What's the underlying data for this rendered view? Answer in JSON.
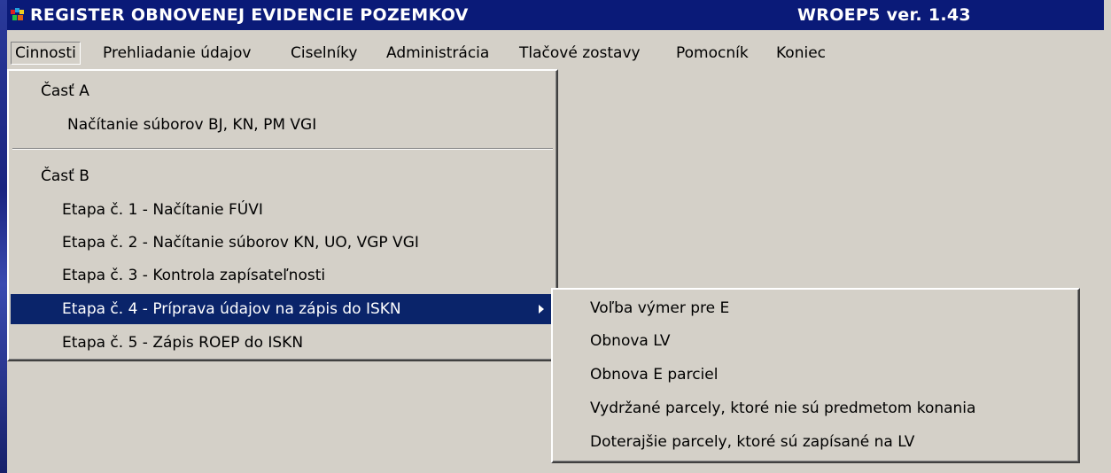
{
  "window": {
    "title": "REGISTER OBNOVENEJ EVIDENCIE POZEMKOV",
    "version": "WROEP5 ver. 1.43"
  },
  "menubar": {
    "items": [
      {
        "label": "Cinnosti"
      },
      {
        "label": "Prehliadanie údajov"
      },
      {
        "label": "Ciselníky"
      },
      {
        "label": "Administrácia"
      },
      {
        "label": "Tlačové zostavy"
      },
      {
        "label": "Pomocník"
      },
      {
        "label": "Koniec"
      }
    ]
  },
  "dropdown": {
    "section_a": "Časť A",
    "a_items": [
      "Načítanie súborov BJ, KN, PM VGI"
    ],
    "section_b": "Časť B",
    "b_items": [
      "Etapa č. 1 - Načítanie FÚVI",
      "Etapa č. 2 - Načítanie súborov KN, UO, VGP VGI",
      "Etapa č. 3 - Kontrola zapísateľnosti",
      "Etapa č. 4 - Príprava  údajov na zápis do ISKN",
      "Etapa č. 5 - Zápis ROEP do ISKN"
    ]
  },
  "submenu": {
    "items": [
      "Voľba výmer pre E",
      "Obnova LV",
      "Obnova E parciel",
      "Vydržané parcely, ktoré nie sú predmetom konania",
      "Doterajšie parcely, ktoré sú zapísané na LV"
    ]
  },
  "colors": {
    "titlebar": "#0a1a78",
    "highlight": "#0a246a",
    "face": "#d4d0c8"
  }
}
